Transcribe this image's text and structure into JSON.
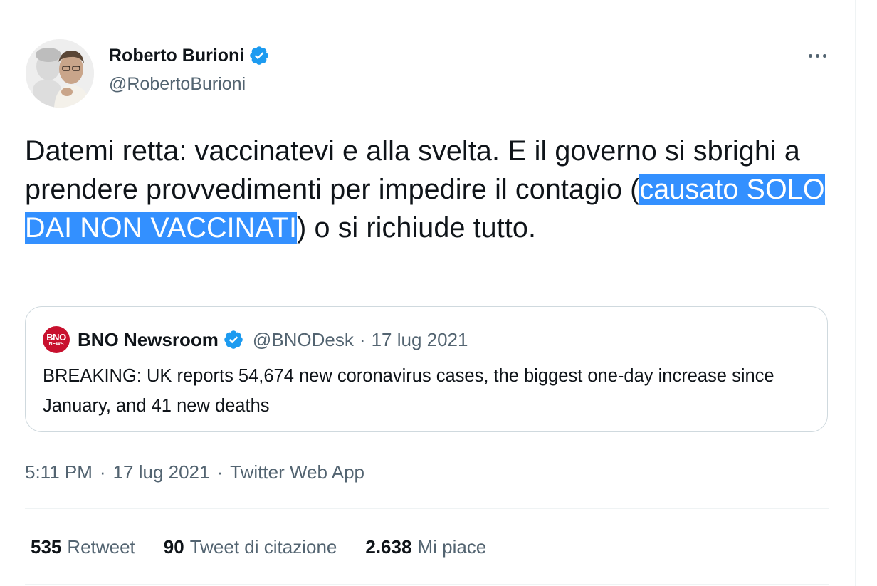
{
  "author": {
    "name": "Roberto Burioni",
    "handle": "@RobertoBurioni",
    "verified_icon": "verified-badge-icon",
    "avatar": "avatar-photo"
  },
  "tweet": {
    "text_before": "Datemi retta: vaccinatevi e alla svelta. E il governo si sbrighi a prendere provvedimenti per impedire il contagio (",
    "text_highlighted": "causato SOLO DAI NON VACCINATI",
    "text_after": ") o si richiude tutto."
  },
  "quoted_tweet": {
    "avatar_text_top": "BNO",
    "avatar_text_bottom": "NEWS",
    "name": "BNO Newsroom",
    "handle": "@BNODesk",
    "separator": "·",
    "date": "17 lug 2021",
    "text": "BREAKING: UK reports 54,674 new coronavirus cases, the biggest one-day increase since January, and 41 new deaths"
  },
  "meta": {
    "time": "5:11 PM",
    "separator": "·",
    "date": "17 lug 2021",
    "source": "Twitter Web App"
  },
  "stats": {
    "retweets_count": "535",
    "retweets_label": "Retweet",
    "quotes_count": "90",
    "quotes_label": "Tweet di citazione",
    "likes_count": "2.638",
    "likes_label": "Mi piace"
  },
  "colors": {
    "verified": "#1d9bf0",
    "highlight": "#3390ff",
    "secondary_text": "#536471",
    "primary_text": "#0f1419",
    "border": "#cfd9de",
    "bno_red": "#c8102e"
  }
}
